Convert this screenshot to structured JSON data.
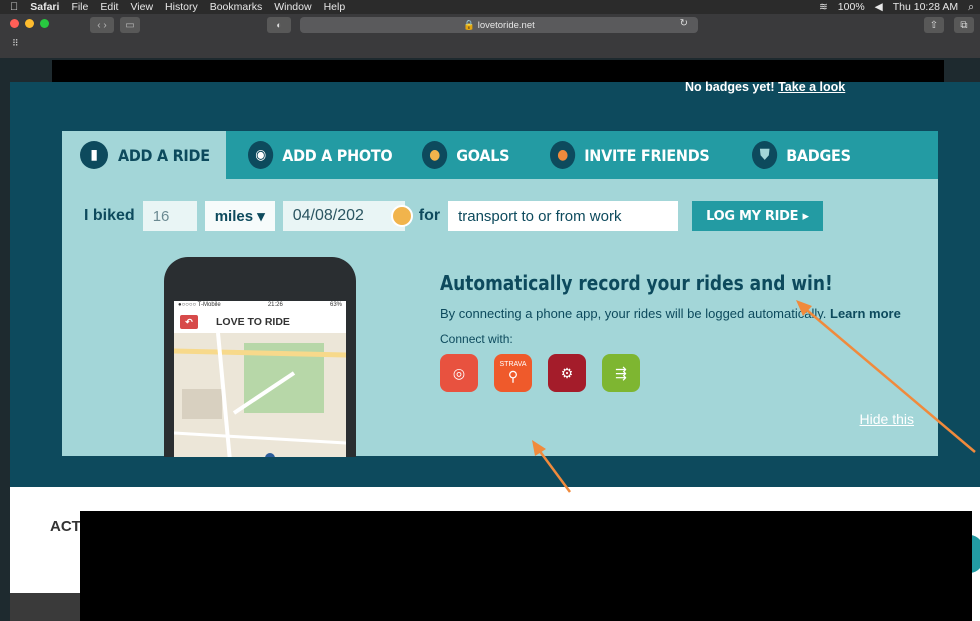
{
  "menubar": {
    "apple": "",
    "app": "Safari",
    "menus": [
      "File",
      "Edit",
      "View",
      "History",
      "Bookmarks",
      "Window",
      "Help"
    ],
    "battery": "100%",
    "clock": "Thu 10:28 AM"
  },
  "browser": {
    "url": "lovetoride.net"
  },
  "page": {
    "badges_text": "No badges yet!",
    "badges_link": "Take a look",
    "tabs": [
      "ADD A RIDE",
      "ADD A PHOTO",
      "GOALS",
      "INVITE FRIENDS",
      "BADGES"
    ],
    "form": {
      "prefix": "I biked",
      "distance": "16",
      "unit": "miles ▾",
      "date": "04/08/202",
      "for_label": "for",
      "purpose": "transport to or from work",
      "log_button": "LOG MY RIDE ▸"
    },
    "promo": {
      "title": "Automatically record your rides and win!",
      "text": "By connecting a phone app, your rides will be logged automatically.",
      "learn": "Learn more",
      "connect_label": "Connect with:",
      "apps": [
        "app-1",
        "strava",
        "app-3",
        "app-4"
      ],
      "strava_label": "STRAVA",
      "hide": "Hide this"
    },
    "phone": {
      "carrier": "●○○○○ T-Mobile",
      "time": "21:26",
      "battery": "63%",
      "logo": "LOVE TO RIDE"
    },
    "activity_label": "ACT"
  },
  "colors": {
    "page_bg": "#0d4a5d",
    "tab_bar": "#239ba3",
    "card": "#a3d6d8",
    "arrow": "#f08a3c"
  }
}
